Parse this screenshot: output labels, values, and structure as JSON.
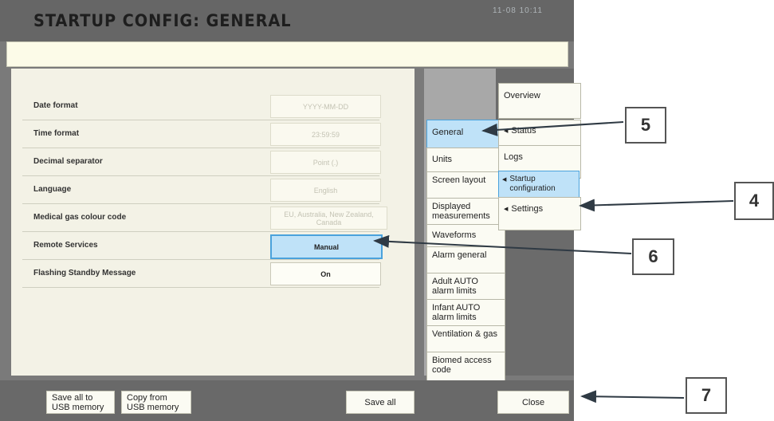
{
  "header": {
    "title": "STARTUP CONFIG: GENERAL",
    "clock": "11-08  10:11"
  },
  "settings": [
    {
      "label": "Date format",
      "value": "YYYY-MM-DD",
      "state": "disabled"
    },
    {
      "label": "Time format",
      "value": "23:59:59",
      "state": "disabled"
    },
    {
      "label": "Decimal separator",
      "value": "Point (.)",
      "state": "disabled"
    },
    {
      "label": "Language",
      "value": "English",
      "state": "disabled"
    },
    {
      "label": "Medical gas colour code",
      "value": "EU, Australia, New Zealand, Canada",
      "state": "disabled"
    },
    {
      "label": "Remote Services",
      "value": "Manual",
      "state": "selected"
    },
    {
      "label": "Flashing Standby Message",
      "value": "On",
      "state": "enabled"
    }
  ],
  "tabs": [
    {
      "label": "General",
      "active": true
    },
    {
      "label": "Units"
    },
    {
      "label": "Screen layout"
    },
    {
      "label": "Displayed measurements"
    },
    {
      "label": "Waveforms"
    },
    {
      "label": "Alarm general"
    },
    {
      "label": "Adult AUTO alarm limits"
    },
    {
      "label": "Infant AUTO alarm limits"
    },
    {
      "label": "Ventilation & gas"
    },
    {
      "label": "Biomed access code"
    }
  ],
  "nav": {
    "overview": "Overview",
    "status": "Status",
    "logs": "Logs",
    "startup": "Startup configuration",
    "settings": "Settings"
  },
  "bottom": {
    "save_usb": "Save all to USB memory",
    "copy_usb": "Copy from USB memory",
    "save_all": "Save all",
    "close": "Close"
  },
  "callouts": {
    "c4": "4",
    "c5": "5",
    "c6": "6",
    "c7": "7"
  },
  "colors": {
    "selected_bg": "#bfe2f8",
    "selected_border": "#4aa2dc",
    "frame": "#7a7a7a"
  }
}
